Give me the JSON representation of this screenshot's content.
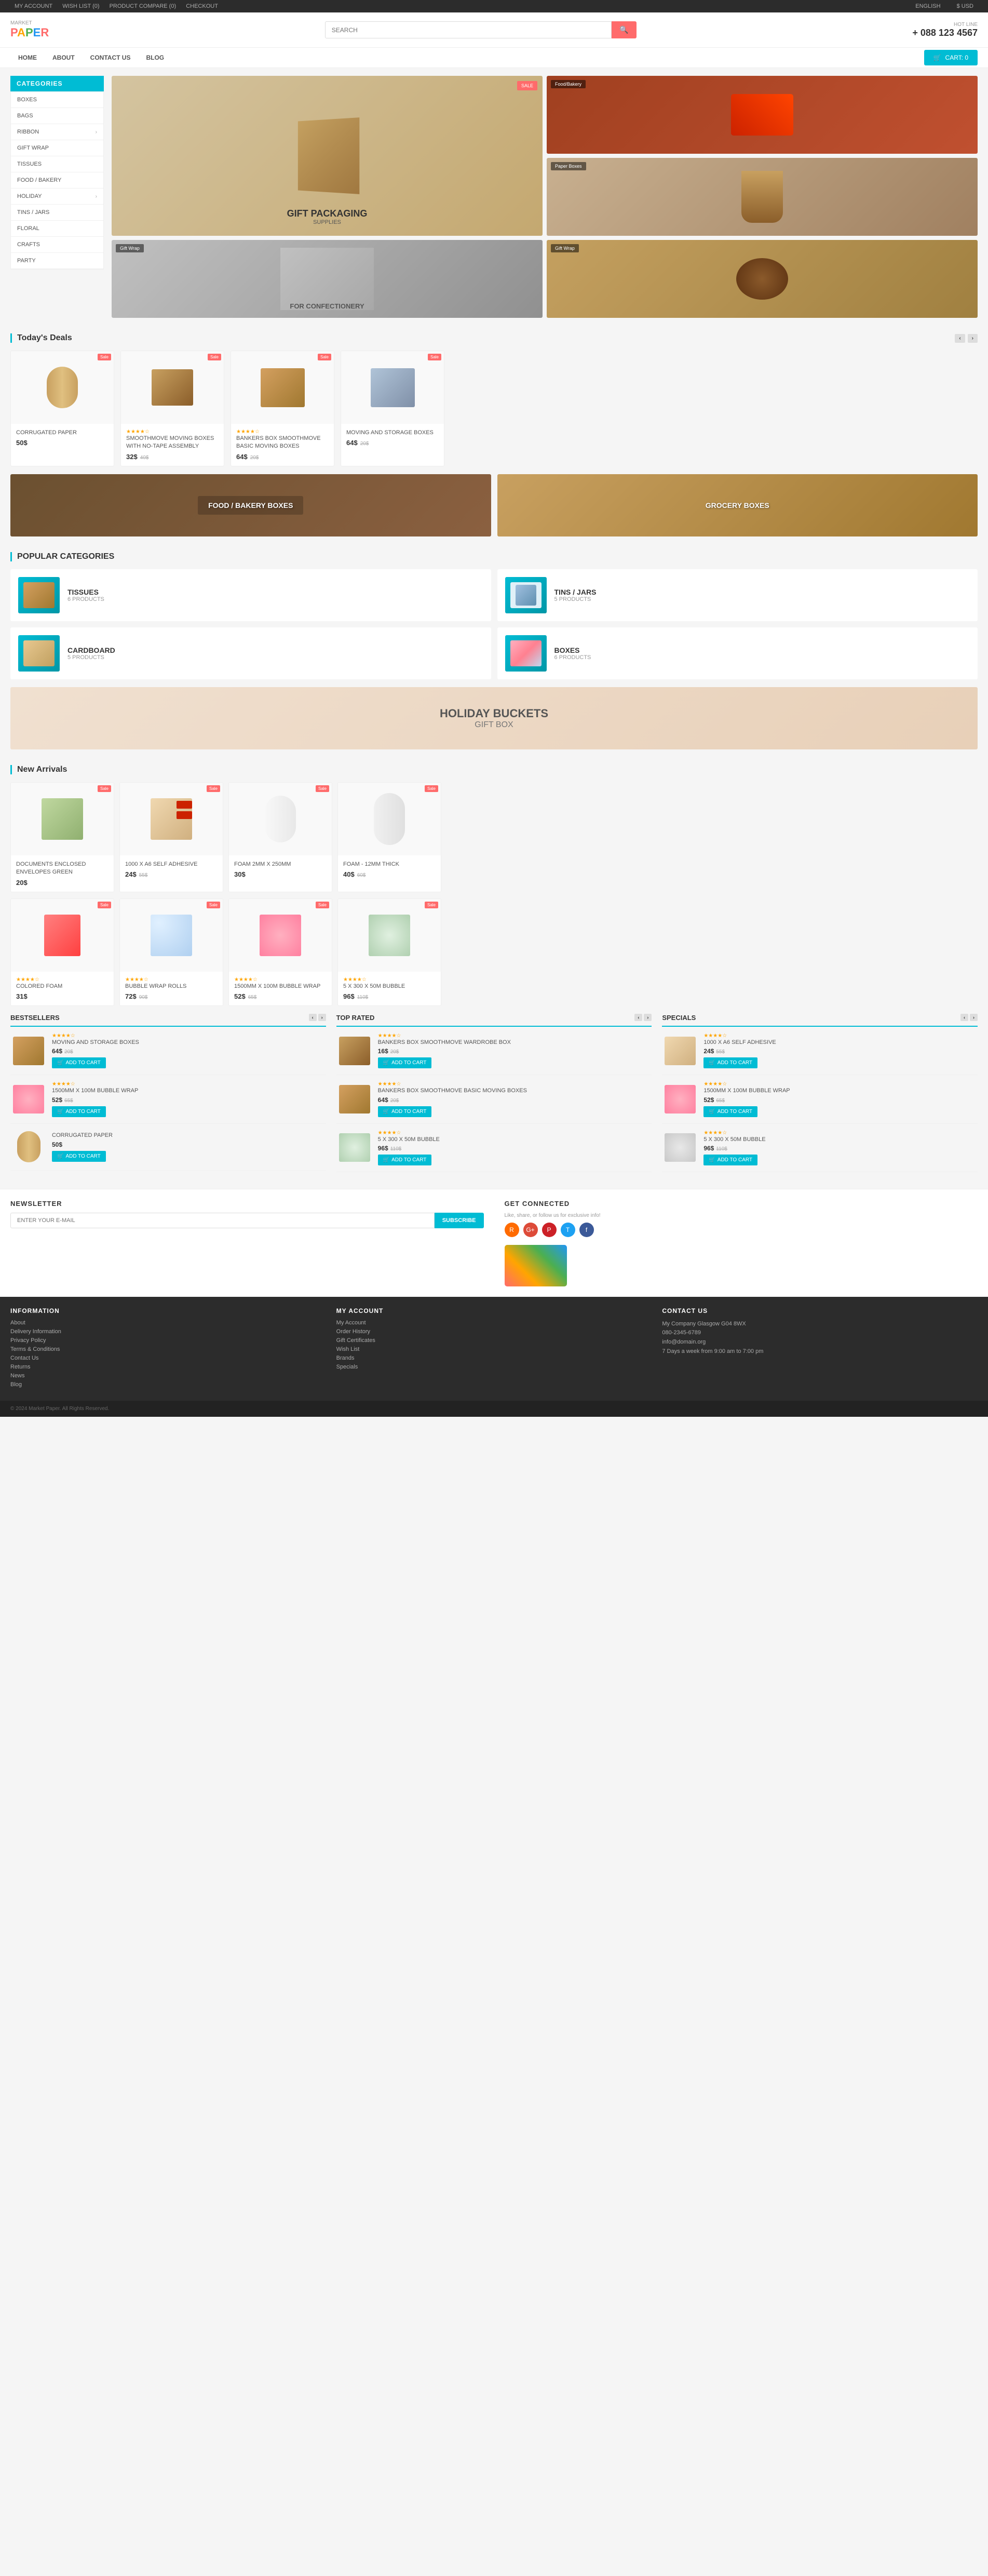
{
  "topbar": {
    "links": [
      "MY ACCOUNT",
      "WISH LIST (0)",
      "PRODUCT COMPARE (0)",
      "CHECKOUT"
    ],
    "right": {
      "language": "ENGLISH",
      "currency": "$ USD"
    }
  },
  "header": {
    "logo": {
      "market": "MARKET",
      "letters": [
        "P",
        "A",
        "P",
        "E",
        "R"
      ]
    },
    "search_placeholder": "SEARCH",
    "hotline_label": "HOT LINE",
    "hotline_number": "+ 088 123 4567"
  },
  "nav": {
    "links": [
      "HOME",
      "ABOUT",
      "CONTACT US",
      "BLOG"
    ],
    "cart_label": "CART: 0"
  },
  "sidebar": {
    "title": "CATEGORIES",
    "items": [
      {
        "label": "BOXES",
        "has_arrow": false
      },
      {
        "label": "BAGS",
        "has_arrow": false
      },
      {
        "label": "RIBBON",
        "has_arrow": true
      },
      {
        "label": "GIFT WRAP",
        "has_arrow": false
      },
      {
        "label": "TISSUES",
        "has_arrow": false
      },
      {
        "label": "FOOD / BAKERY",
        "has_arrow": false
      },
      {
        "label": "HOLIDAY",
        "has_arrow": true
      },
      {
        "label": "TINS / JARS",
        "has_arrow": false
      },
      {
        "label": "FLORAL",
        "has_arrow": false
      },
      {
        "label": "CRAFTS",
        "has_arrow": false
      },
      {
        "label": "PARTY",
        "has_arrow": false
      }
    ]
  },
  "hero": {
    "main": {
      "title": "GIFT PACKAGING",
      "subtitle": "SUPPLIES",
      "badge": "SALE"
    },
    "sub1": {
      "badge": "Food/Bakery",
      "color": "#c8a882"
    },
    "sub2": {
      "badge": "Paper Boxes",
      "color": "#a89070"
    },
    "sub3": {
      "badge": "Gift Wrap",
      "label": "FOR CONFECTIONERY",
      "color": "#b0a090"
    },
    "sub4": {
      "badge": "Gift Wrap",
      "color": "#c4a060"
    }
  },
  "todays_deals": {
    "title": "Today's Deals",
    "products": [
      {
        "name": "CORRUGATED PAPER",
        "price": "50$",
        "old_price": "",
        "badge": "Sale",
        "stars": 0
      },
      {
        "name": "SMOOTHMOVE MOVING BOXES WITH NO-TAPE ASSEMBLY",
        "price": "32$",
        "old_price": "40$",
        "badge": "Sale",
        "stars": 4
      },
      {
        "name": "BANKERS BOX SMOOTHMOVE BASIC MOVING BOXES",
        "price": "64$",
        "old_price": "20$",
        "badge": "Sale",
        "stars": 4
      },
      {
        "name": "MOVING AND STORAGE BOXES",
        "price": "64$",
        "old_price": "20$",
        "badge": "Sale",
        "stars": 0
      }
    ]
  },
  "promo_banners": [
    {
      "label": "FOOD / BAKERY BOXES",
      "color": "#8b7355"
    },
    {
      "label": "GROCERY BOXES",
      "color": "#c8a060"
    }
  ],
  "popular_categories": {
    "title": "POPULAR CATEGORIES",
    "items": [
      {
        "name": "TISSUES",
        "count": "6 PRODUCTS",
        "color": "#00bcd4"
      },
      {
        "name": "TINS / JARS",
        "count": "5 PRODUCTS",
        "color": "#00bcd4"
      },
      {
        "name": "CARDBOARD",
        "count": "5 PRODUCTS",
        "color": "#00bcd4"
      },
      {
        "name": "BOXES",
        "count": "6 PRODUCTS",
        "color": "#00bcd4"
      }
    ]
  },
  "holiday_banner": {
    "label": "HOLIDAY BUCKETS",
    "sublabel": "GIFT BOX"
  },
  "new_arrivals": {
    "title": "New Arrivals",
    "products": [
      {
        "name": "DOCUMENTS ENCLOSED ENVELOPES GREEN",
        "price": "20$",
        "old_price": "",
        "badge": "Sale"
      },
      {
        "name": "1000 X A6 SELF ADHESIVE",
        "price": "24$",
        "old_price": "55$",
        "badge": "Sale"
      },
      {
        "name": "FOAM 2MM X 250MM",
        "price": "30$",
        "old_price": "",
        "badge": "Sale"
      },
      {
        "name": "FOAM - 12MM THICK",
        "price": "40$",
        "old_price": "60$",
        "badge": "Sale"
      },
      {
        "name": "COLORED FOAM",
        "price": "31$",
        "old_price": "",
        "badge": "Sale",
        "stars": 4
      },
      {
        "name": "BUBBLE WRAP ROLLS",
        "price": "72$",
        "old_price": "90$",
        "badge": "Sale",
        "stars": 4
      },
      {
        "name": "1500MM X 100M BUBBLE WRAP",
        "price": "52$",
        "old_price": "65$",
        "badge": "Sale",
        "stars": 4
      },
      {
        "name": "5 X 300 X 50M BUBBLE",
        "price": "96$",
        "old_price": "110$",
        "badge": "Sale",
        "stars": 4
      }
    ]
  },
  "bestsellers": {
    "title": "BESTSELLERS",
    "items": [
      {
        "name": "MOVING AND STORAGE BOXES",
        "price": "64$",
        "old_price": "20$",
        "stars": 4,
        "add_to_cart": "ADD TO CART"
      },
      {
        "name": "1500MM X 100M BUBBLE WRAP",
        "price": "52$",
        "old_price": "65$",
        "stars": 4,
        "add_to_cart": "ADD TO CART"
      },
      {
        "name": "CORRUGATED PAPER",
        "price": "50$",
        "old_price": "",
        "stars": 0,
        "add_to_cart": "ADD TO CART"
      }
    ]
  },
  "top_rated": {
    "title": "TOP RATED",
    "items": [
      {
        "name": "BANKERS BOX SMOOTHMOVE WARDROBE BOX",
        "price": "16$",
        "old_price": "20$",
        "stars": 4,
        "add_to_cart": "ADD TO CART"
      },
      {
        "name": "BANKERS BOX SMOOTHMOVE BASIC MOVING BOXES",
        "price": "64$",
        "old_price": "20$",
        "stars": 4,
        "add_to_cart": "ADD TO CART"
      },
      {
        "name": "5 X 300 X 50M BUBBLE",
        "price": "96$",
        "old_price": "110$",
        "stars": 4,
        "add_to_cart": "ADD TO CART"
      }
    ]
  },
  "specials": {
    "title": "SPECIALS",
    "items": [
      {
        "name": "1000 X A6 SELF ADHESIVE",
        "price": "24$",
        "old_price": "55$",
        "stars": 4,
        "add_to_cart": "ADD TO CART"
      },
      {
        "name": "1500MM X 100M BUBBLE WRAP",
        "price": "52$",
        "old_price": "65$",
        "stars": 4,
        "add_to_cart": "ADD TO CART"
      },
      {
        "name": "5 X 300 X 50M BUBBLE",
        "price": "96$",
        "old_price": "110$",
        "stars": 4,
        "add_to_cart": "ADD TO CART"
      }
    ]
  },
  "newsletter": {
    "title": "NEWSLETTER",
    "placeholder": "ENTER YOUR E-MAIL",
    "button": "SUBSCRIBE",
    "social_title": "GET CONNECTED",
    "social_subtitle": "Like, share, or follow us for exclusive info!",
    "social_icons": [
      {
        "name": "rss",
        "color": "#ff6b00",
        "symbol": "R"
      },
      {
        "name": "google-plus",
        "color": "#dd4b39",
        "symbol": "G+"
      },
      {
        "name": "pinterest",
        "color": "#cc2127",
        "symbol": "P"
      },
      {
        "name": "twitter",
        "color": "#1da1f2",
        "symbol": "T"
      },
      {
        "name": "facebook",
        "color": "#3b5998",
        "symbol": "f"
      }
    ]
  },
  "footer": {
    "information": {
      "title": "INFORMATION",
      "links": [
        "About",
        "Delivery Information",
        "Privacy Policy",
        "Terms & Conditions",
        "Contact Us",
        "Returns",
        "News",
        "Blog"
      ]
    },
    "my_account": {
      "title": "MY ACCOUNT",
      "links": [
        "My Account",
        "Order History",
        "Gift Certificates",
        "Wish List",
        "Brands",
        "Specials"
      ]
    },
    "contact": {
      "title": "CONTACT US",
      "address": "My Company Glasgow G04 8WX",
      "phone": "080-2345-6789",
      "email": "info@domain.org",
      "hours": "7 Days a week from 9:00 am to 7:00 pm"
    }
  },
  "colors": {
    "primary": "#00bcd4",
    "accent": "#ff6b6b",
    "dark": "#2c2c2c",
    "sale_badge": "#ff6b6b",
    "new_badge": "#4caf50"
  }
}
